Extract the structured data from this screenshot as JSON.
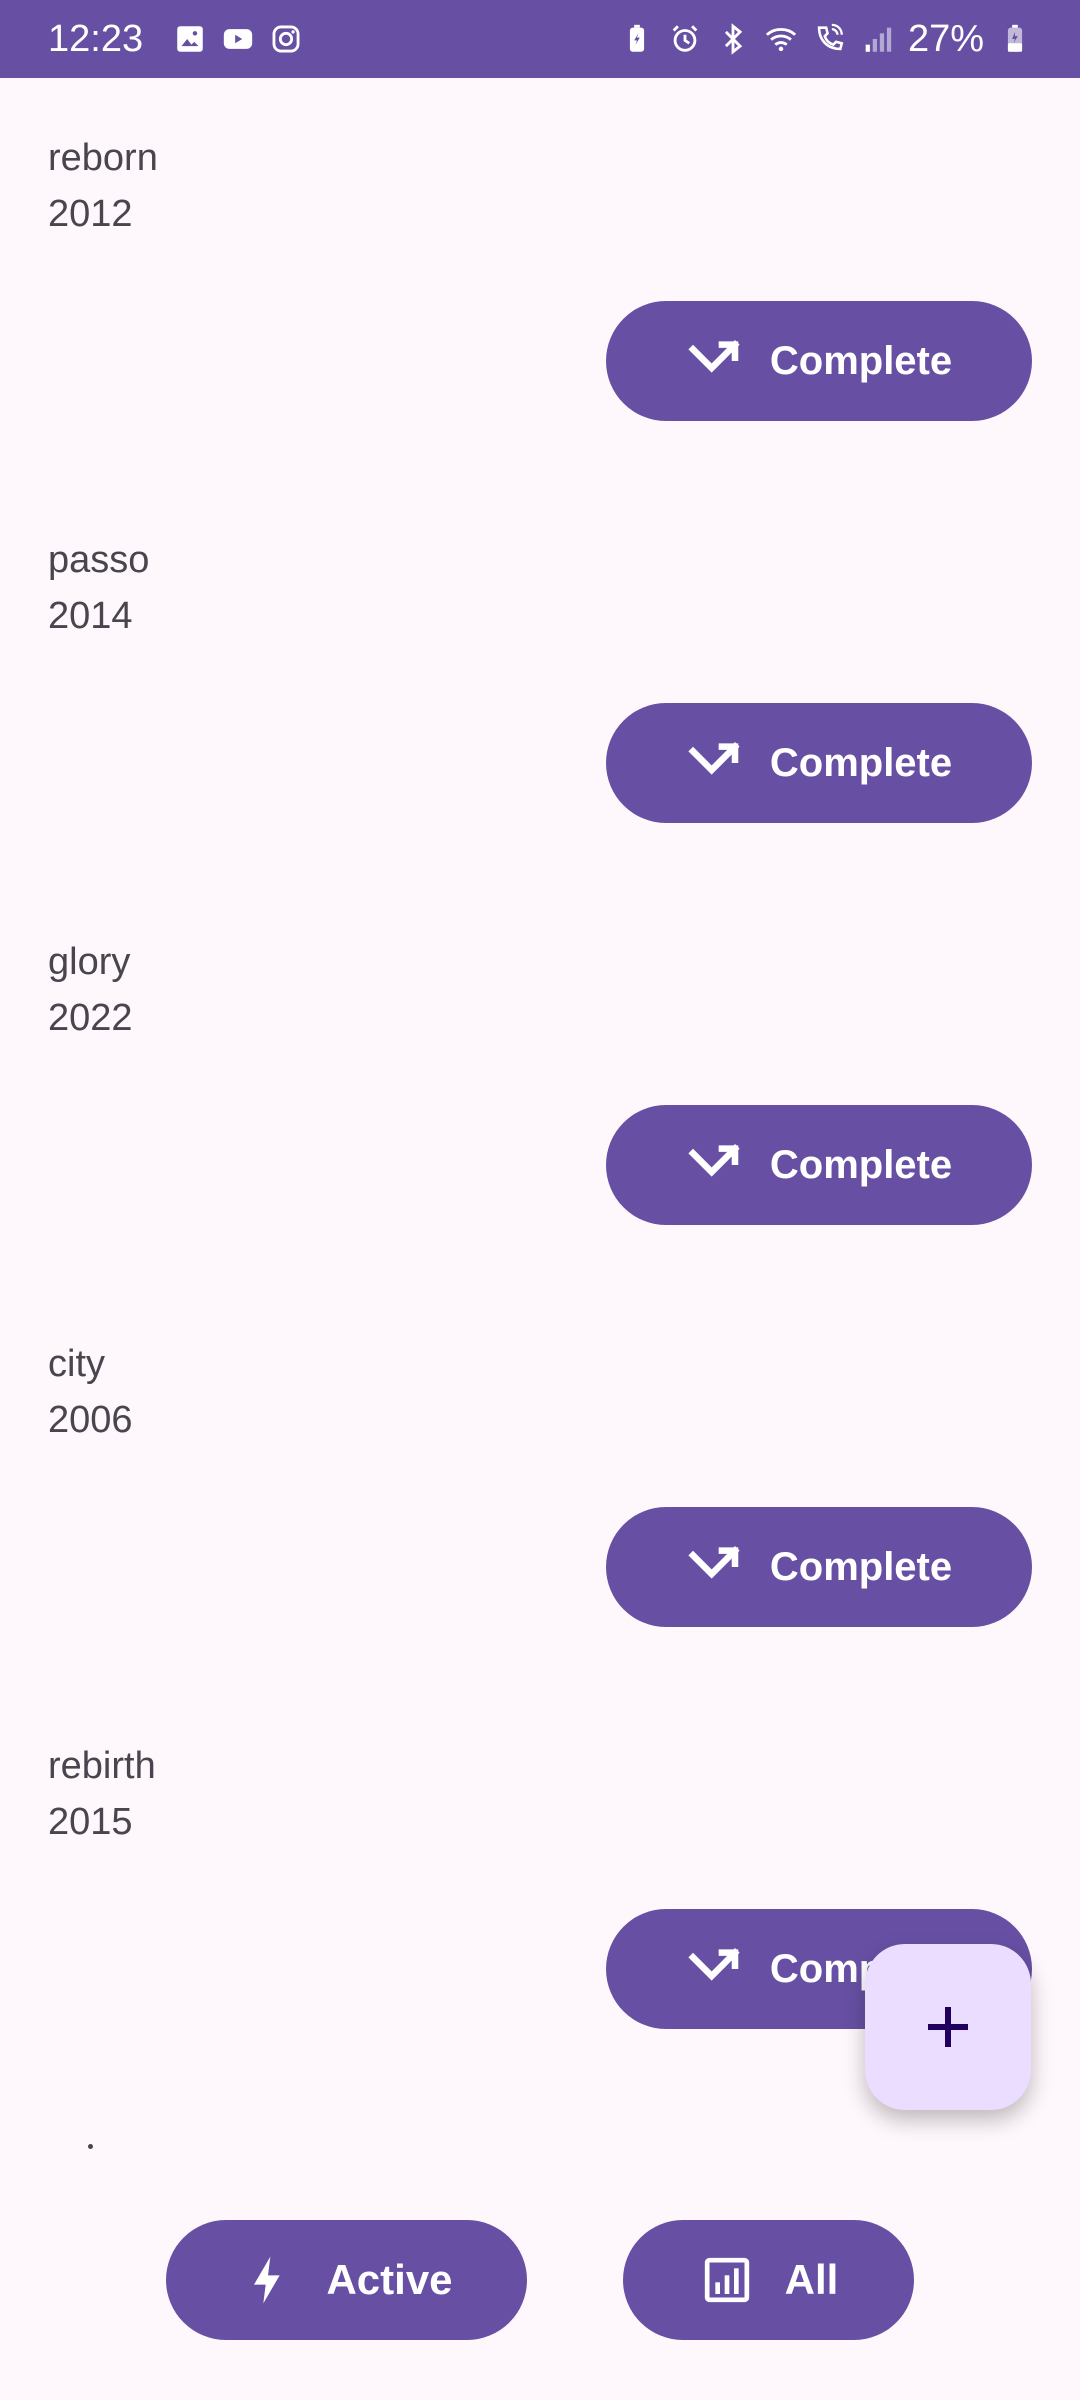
{
  "status_bar": {
    "time": "12:23",
    "battery": "27%",
    "left_icons": [
      "gallery-icon",
      "youtube-icon",
      "instagram-icon"
    ],
    "right_icons": [
      "battery-saver-icon",
      "alarm-icon",
      "bluetooth-icon",
      "wifi-icon",
      "wifi-call-icon",
      "signal-icon",
      "battery-charging-icon"
    ]
  },
  "tasks": [
    {
      "name": "reborn",
      "year": "2012",
      "action": "Complete"
    },
    {
      "name": "passo",
      "year": "2014",
      "action": "Complete"
    },
    {
      "name": "glory",
      "year": "2022",
      "action": "Complete"
    },
    {
      "name": "city",
      "year": "2006",
      "action": "Complete"
    },
    {
      "name": "rebirth",
      "year": "2015",
      "action": "Complete"
    }
  ],
  "fab": {
    "icon": "plus-icon"
  },
  "bottom_bar": {
    "active_label": "Active",
    "all_label": "All"
  },
  "colors": {
    "primary": "#6750A4",
    "background": "#FEF7FB",
    "fab": "#EADDFF",
    "text": "#49454F"
  }
}
